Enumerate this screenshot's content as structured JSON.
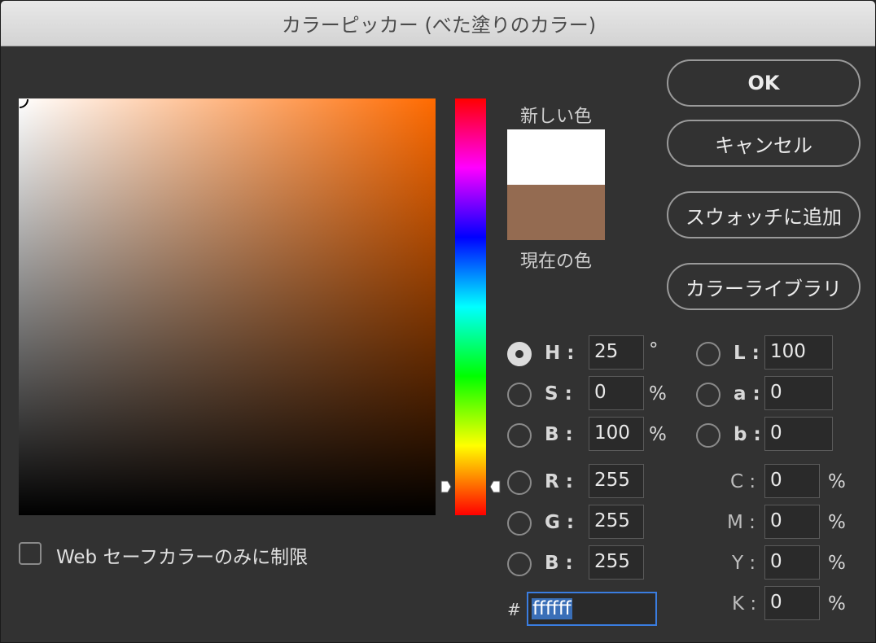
{
  "window": {
    "title": "カラーピッカー (べた塗りのカラー)"
  },
  "swatches": {
    "new_label": "新しい色",
    "current_label": "現在の色",
    "new_color": "#ffffff",
    "current_color": "#946b51"
  },
  "buttons": {
    "ok": "OK",
    "cancel": "キャンセル",
    "add_swatch": "スウォッチに追加",
    "color_library": "カラーライブラリ"
  },
  "hsb": {
    "h_label": "H :",
    "h_value": "25",
    "h_unit": "°",
    "s_label": "S :",
    "s_value": "0",
    "s_unit": "%",
    "b_label": "B :",
    "b_value": "100",
    "b_unit": "%"
  },
  "rgb": {
    "r_label": "R :",
    "r_value": "255",
    "g_label": "G :",
    "g_value": "255",
    "b_label": "B :",
    "b_value": "255"
  },
  "lab": {
    "l_label": "L :",
    "l_value": "100",
    "a_label": "a :",
    "a_value": "0",
    "b_label": "b :",
    "b_value": "0"
  },
  "cmyk": {
    "c_label": "C :",
    "c_value": "0",
    "m_label": "M :",
    "m_value": "0",
    "y_label": "Y :",
    "y_value": "0",
    "k_label": "K :",
    "k_value": "0",
    "unit": "%"
  },
  "hex": {
    "label": "#",
    "value": "ffffff"
  },
  "web_safe": {
    "label": "Web セーフカラーのみに制限",
    "checked": false
  },
  "selected_mode": "H"
}
